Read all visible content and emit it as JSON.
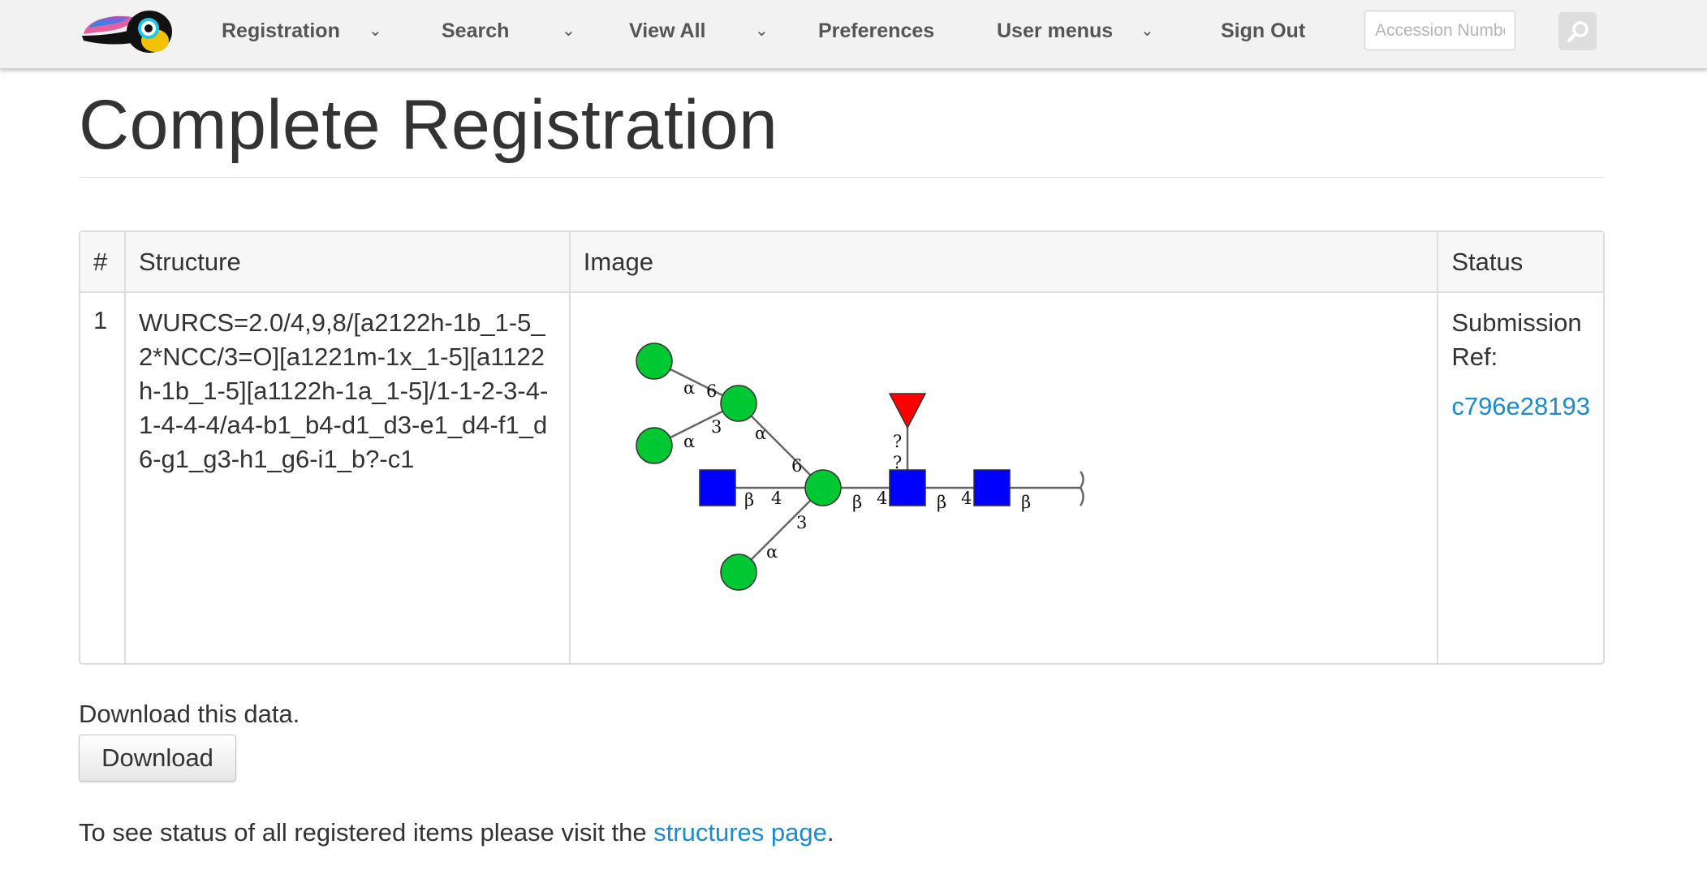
{
  "nav": {
    "items": [
      {
        "label": "Registration",
        "dropdown": true
      },
      {
        "label": "Search",
        "dropdown": true
      },
      {
        "label": "View All",
        "dropdown": true
      },
      {
        "label": "Preferences",
        "dropdown": false
      },
      {
        "label": "User menus",
        "dropdown": true
      },
      {
        "label": "Sign Out",
        "dropdown": false
      }
    ],
    "caret_glyph": "⌄",
    "search": {
      "placeholder": "Accession Number",
      "value": "",
      "icon": "search-icon"
    },
    "logo_icon": "toucan-logo"
  },
  "page": {
    "title": "Complete Registration"
  },
  "table": {
    "headers": [
      "#",
      "Structure",
      "Image",
      "Status"
    ],
    "rows": [
      {
        "num": "1",
        "structure": "WURCS=2.0/4,9,8/[a2122h-1b_1-5_2*NCC/3=O][a1221m-1x_1-5][a1122h-1b_1-5][a1122h-1a_1-5]/1-1-2-3-4-1-4-4-4/a4-b1_b4-d1_d3-e1_d4-f1_d6-g1_g3-h1_g6-i1_b?-c1",
        "status_label": "Submission Ref:",
        "ref": "c796e28193"
      }
    ]
  },
  "glycan": {
    "colors": {
      "glcnac": "#0000ff",
      "mannose": "#00c832",
      "fucose": "#ff0000",
      "line": "#666666"
    },
    "labels": {
      "alpha": "α",
      "beta": "β",
      "unknown": "?",
      "pos3": "3",
      "pos4": "4",
      "pos6": "6"
    }
  },
  "download": {
    "text": "Download this data.",
    "button_label": "Download"
  },
  "footer": {
    "text_before": "To see status of all registered items please visit the ",
    "link_text": "structures page",
    "text_after": "."
  },
  "colors": {
    "navbar_bg": "#f2f2f2",
    "link": "#1b8bd0",
    "text": "#333333",
    "nav_text": "#555555",
    "table_border": "#dddddd",
    "table_header_bg": "#f7f7f7"
  }
}
